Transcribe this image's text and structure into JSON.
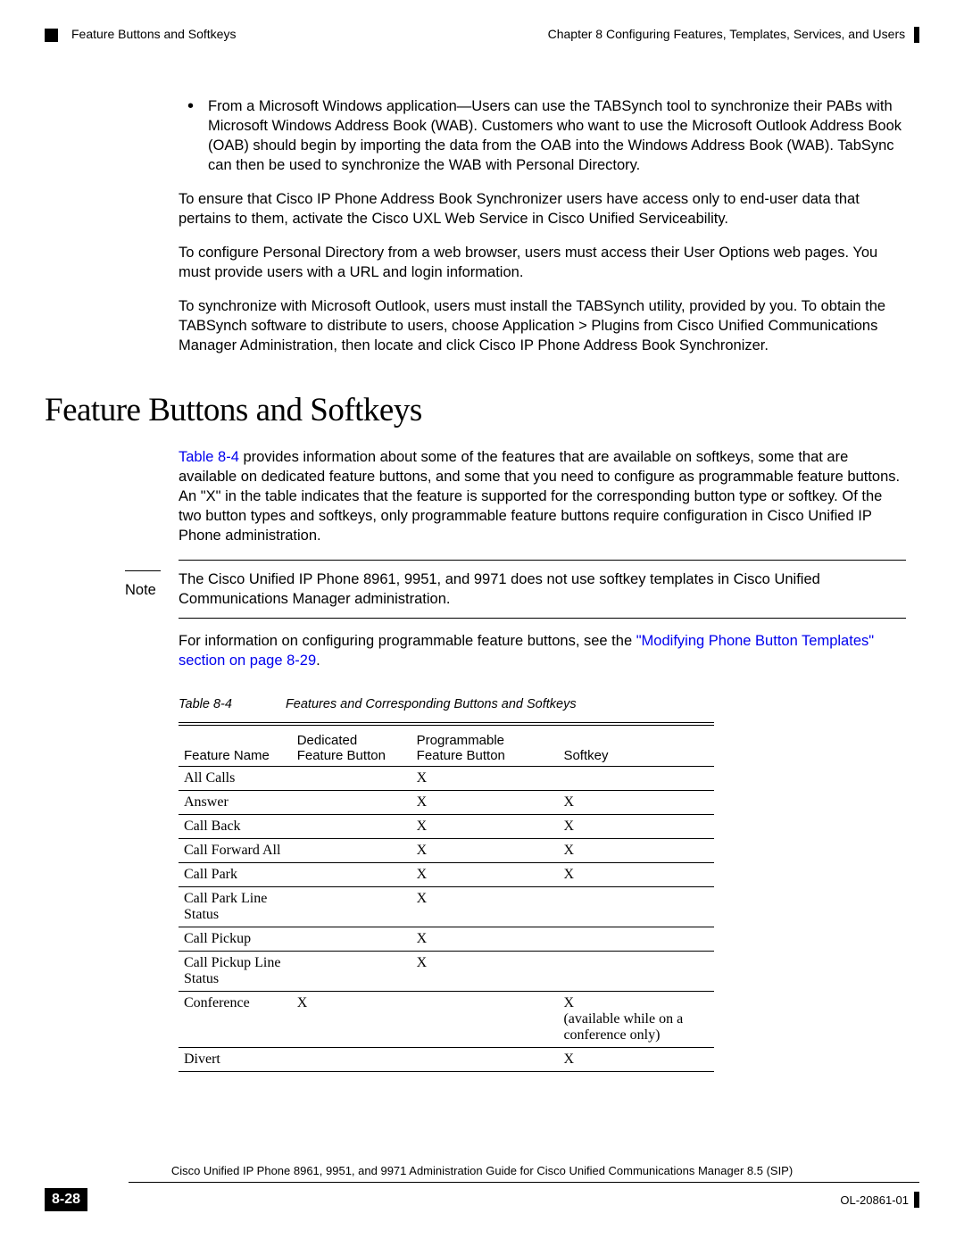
{
  "header": {
    "chapter_line": "Chapter 8      Configuring Features, Templates, Services, and Users",
    "section_name": "Feature Buttons and Softkeys"
  },
  "content": {
    "bullet_text": "From a Microsoft Windows application—Users can use the TABSynch tool to synchronize their PABs with Microsoft Windows Address Book (WAB). Customers who want to use the Microsoft Outlook Address Book (OAB) should begin by importing the data from the OAB into the Windows Address Book (WAB). TabSync can then be used to synchronize the WAB with Personal Directory.",
    "para1": "To ensure that Cisco IP Phone Address Book Synchronizer users have access only to end-user data that pertains to them, activate the Cisco UXL Web Service in Cisco Unified Serviceability.",
    "para2": "To configure Personal Directory from a web browser, users must access their User Options web pages. You must provide users with a URL and login information.",
    "para3": "To synchronize with Microsoft Outlook, users must install the TABSynch utility, provided by you. To obtain the TABSynch software to distribute to users, choose Application > Plugins from Cisco Unified Communications Manager Administration, then locate and click Cisco IP Phone Address Book Synchronizer.",
    "h1": "Feature Buttons and Softkeys",
    "para4_pre": "Table 8-4",
    "para4_post": " provides information about some of the features that are available on softkeys, some that are available on dedicated feature buttons, and some that you need to configure as programmable feature buttons. An \"X\" in the table indicates that the feature is supported for the corresponding button type or softkey. Of the two button types and softkeys, only programmable feature buttons require configuration in Cisco Unified IP Phone administration.",
    "note_label": "Note",
    "note_text": "The Cisco Unified IP Phone 8961, 9951, and 9971 does not use softkey templates in Cisco Unified Communications Manager administration.",
    "para5_pre": "For information on configuring programmable feature buttons, see the ",
    "para5_link": "\"Modifying Phone Button Templates\" section on page 8-29",
    "para5_post": ".",
    "table_num": "Table 8-4",
    "table_title": "Features and Corresponding Buttons and Softkeys",
    "col1": "Feature Name",
    "col2": "Dedicated Feature Button",
    "col3": "Programmable Feature Button",
    "col4": "Softkey",
    "rows": [
      {
        "name": "All Calls",
        "c2": "",
        "c3": "X",
        "c4": ""
      },
      {
        "name": "Answer",
        "c2": "",
        "c3": "X",
        "c4": "X"
      },
      {
        "name": "Call Back",
        "c2": "",
        "c3": "X",
        "c4": "X"
      },
      {
        "name": "Call Forward All",
        "c2": "",
        "c3": "X",
        "c4": "X"
      },
      {
        "name": "Call Park",
        "c2": "",
        "c3": "X",
        "c4": "X"
      },
      {
        "name": "Call Park Line Status",
        "c2": "",
        "c3": "X",
        "c4": ""
      },
      {
        "name": "Call Pickup",
        "c2": "",
        "c3": "X",
        "c4": ""
      },
      {
        "name": "Call Pickup Line Status",
        "c2": "",
        "c3": "X",
        "c4": ""
      },
      {
        "name": "Conference",
        "c2": "X",
        "c3": "",
        "c4": "X\n(available while on a conference only)"
      },
      {
        "name": "Divert",
        "c2": "",
        "c3": "",
        "c4": "X"
      }
    ]
  },
  "footer": {
    "guide": "Cisco Unified IP Phone 8961, 9951, and 9971 Administration Guide for Cisco Unified Communications Manager 8.5 (SIP)",
    "page_number": "8-28",
    "doc_id": "OL-20861-01"
  }
}
